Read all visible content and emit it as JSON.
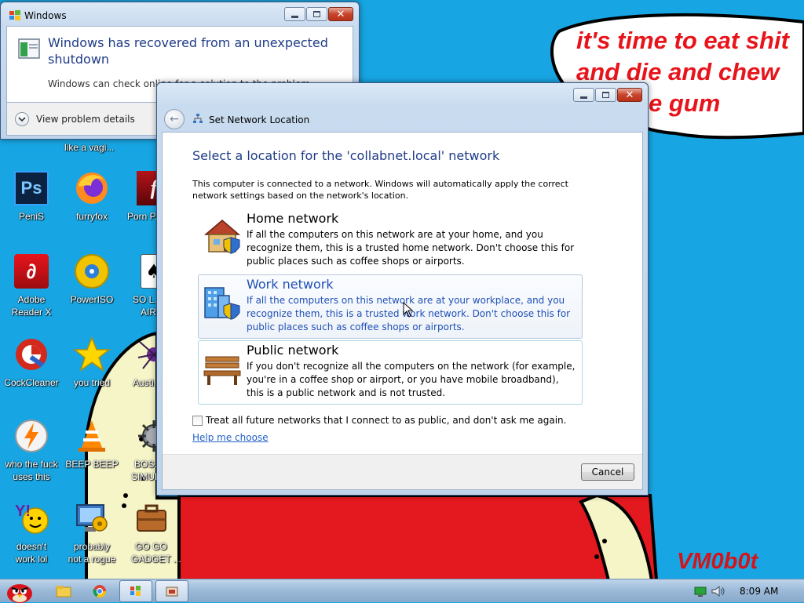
{
  "desktop": {
    "speech_lines": [
      "it's time to eat shit",
      "and die and chew",
      "e gum"
    ],
    "watermark": "VM0b0t",
    "stray_label": "like a vagi...",
    "icons": [
      {
        "label": "PeniS",
        "icon": "photoshop-icon"
      },
      {
        "label": "furryfox",
        "icon": "firefox-icon"
      },
      {
        "label": "Porn P...",
        "icon": "flash-player-icon"
      },
      {
        "label": "Adobe Reader X",
        "label_line2": "Reader X",
        "label_line1": "Adobe",
        "icon": "adobe-reader-icon"
      },
      {
        "label": "PowerISO",
        "icon": "poweriso-icon"
      },
      {
        "label": "SO L... AIR",
        "label_line1": "SO L...",
        "label_line2": "AIR",
        "icon": "solitaire-icon"
      },
      {
        "label": "CockCleaner",
        "icon": "ccleaner-icon"
      },
      {
        "label": "you tried",
        "icon": "star-icon"
      },
      {
        "label": "Austi...",
        "icon": "spider-icon"
      },
      {
        "label_line1": "who the fuck",
        "label_line2": "uses this",
        "icon": "winamp-bolt-icon"
      },
      {
        "label": "BEEP BEEP",
        "icon": "vlc-cone-icon"
      },
      {
        "label_line1": "BOS...",
        "label_line2": "SIMUL...",
        "icon": "gear-ball-icon"
      },
      {
        "label_line1": "doesn't",
        "label_line2": "work lol",
        "icon": "yahoo-messenger-icon"
      },
      {
        "label_line1": "probably",
        "label_line2": "not a rogue",
        "icon": "system-check-icon"
      },
      {
        "label_line1": "GO GO",
        "label_line2": "GADGET ...",
        "icon": "briefcase-icon"
      }
    ]
  },
  "recovered_window": {
    "title": "Windows",
    "heading": "Windows has recovered from an unexpected shutdown",
    "body": "Windows can check online for a solution to the problem.",
    "details_label": "View problem details"
  },
  "network_window": {
    "title": "Set Network Location",
    "heading": "Select a location for the 'collabnet.local' network",
    "intro": "This computer is connected to a network. Windows will automatically apply the correct network settings based on the network's location.",
    "options": [
      {
        "title": "Home network",
        "desc": "If all the computers on this network are at your home, and you recognize them, this is a trusted home network.  Don't choose this for public places such as coffee shops or airports.",
        "icon": "home-network-icon"
      },
      {
        "title": "Work network",
        "desc": "If all the computers on this network are at your workplace, and you recognize them, this is a trusted work network.  Don't choose this for public places such as coffee shops or airports.",
        "icon": "work-network-icon"
      },
      {
        "title": "Public network",
        "desc": "If you don't recognize all the computers on the network (for example, you're in a coffee shop or airport, or you have mobile broadband), this is a public network and is not trusted.",
        "icon": "public-bench-icon"
      }
    ],
    "checkbox_label": "Treat all future networks that I connect to as public, and don't ask me again.",
    "help_link": "Help me choose",
    "cancel_label": "Cancel"
  },
  "taskbar": {
    "time": "8:09 AM",
    "items": [
      "start-angry-bird-icon",
      "explorer-folder-icon",
      "chrome-icon",
      "network-task-icon",
      "recovered-task-icon"
    ]
  },
  "colors": {
    "desktop_bg": "#17a6e3",
    "speech_text": "#e8141b",
    "heading_blue": "#1f3c88",
    "link_blue": "#2260c8"
  }
}
